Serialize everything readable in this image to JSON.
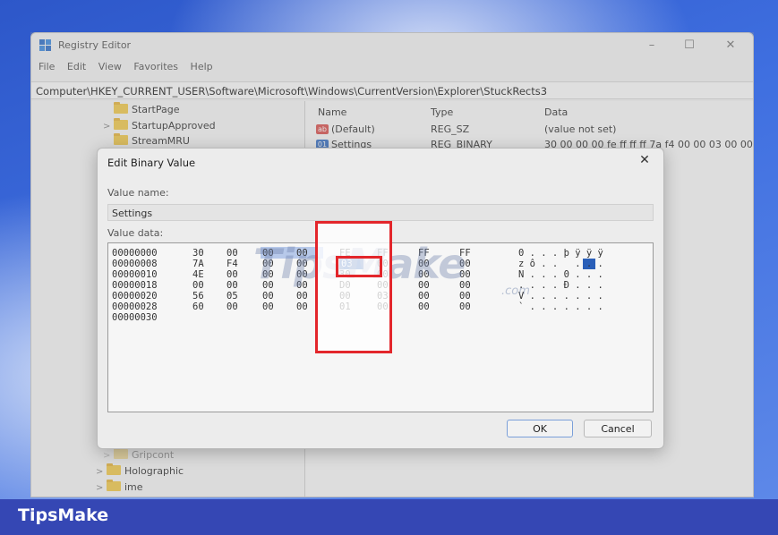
{
  "window": {
    "title": "Registry Editor",
    "menu": [
      "File",
      "Edit",
      "View",
      "Favorites",
      "Help"
    ],
    "controls": {
      "minimize": "–",
      "maximize": "☐",
      "close": "✕"
    },
    "address": "Computer\\HKEY_CURRENT_USER\\Software\\Microsoft\\Windows\\CurrentVersion\\Explorer\\StuckRects3"
  },
  "tree": {
    "items_top": [
      "StartPage",
      "StartupApproved",
      "StreamMRU"
    ],
    "items_bottom": [
      "Gripcont",
      "Holographic",
      "ime"
    ]
  },
  "list": {
    "headers": {
      "name": "Name",
      "type": "Type",
      "data": "Data"
    },
    "rows": [
      {
        "name": "(Default)",
        "type": "REG_SZ",
        "data": "(value not set)"
      },
      {
        "name": "Settings",
        "type": "REG_BINARY",
        "data": "30 00 00 00 fe ff ff ff 7a f4 00 00 03 00 00 00"
      }
    ]
  },
  "dialog": {
    "title": "Edit Binary Value",
    "close": "✕",
    "value_name_label": "Value name:",
    "value_name": "Settings",
    "value_data_label": "Value data:",
    "hex_rows": [
      {
        "offset": "00000000",
        "bytes": [
          "30",
          "00",
          "00",
          "00",
          "FE",
          "FF",
          "FF",
          "FF"
        ],
        "ascii": "0 . . . þ ÿ ÿ ÿ"
      },
      {
        "offset": "00000008",
        "bytes": [
          "7A",
          "F4",
          "00",
          "00",
          "03",
          "00",
          "00",
          "00"
        ],
        "ascii": "z ô . .   . . ."
      },
      {
        "offset": "00000010",
        "bytes": [
          "4E",
          "00",
          "00",
          "00",
          "30",
          "00",
          "00",
          "00"
        ],
        "ascii": "N . . . 0 . . ."
      },
      {
        "offset": "00000018",
        "bytes": [
          "00",
          "00",
          "00",
          "00",
          "D0",
          "00",
          "00",
          "00"
        ],
        "ascii": ". . . . Ð . . ."
      },
      {
        "offset": "00000020",
        "bytes": [
          "56",
          "05",
          "00",
          "00",
          "00",
          "03",
          "00",
          "00"
        ],
        "ascii": "V . . . . . . ."
      },
      {
        "offset": "00000028",
        "bytes": [
          "60",
          "00",
          "00",
          "00",
          "01",
          "00",
          "00",
          "00"
        ],
        "ascii": "` . . . . . . ."
      },
      {
        "offset": "00000030",
        "bytes": [],
        "ascii": ""
      }
    ],
    "selected_byte": "03",
    "ok_label": "OK",
    "cancel_label": "Cancel"
  },
  "watermark": {
    "text": "TipsMake",
    "sub": ".com"
  },
  "banner": {
    "text": "TipsMake"
  },
  "colors": {
    "highlight_red": "#e3262b",
    "banner_blue": "#3547b4",
    "selection_blue": "#2a5fb8"
  }
}
